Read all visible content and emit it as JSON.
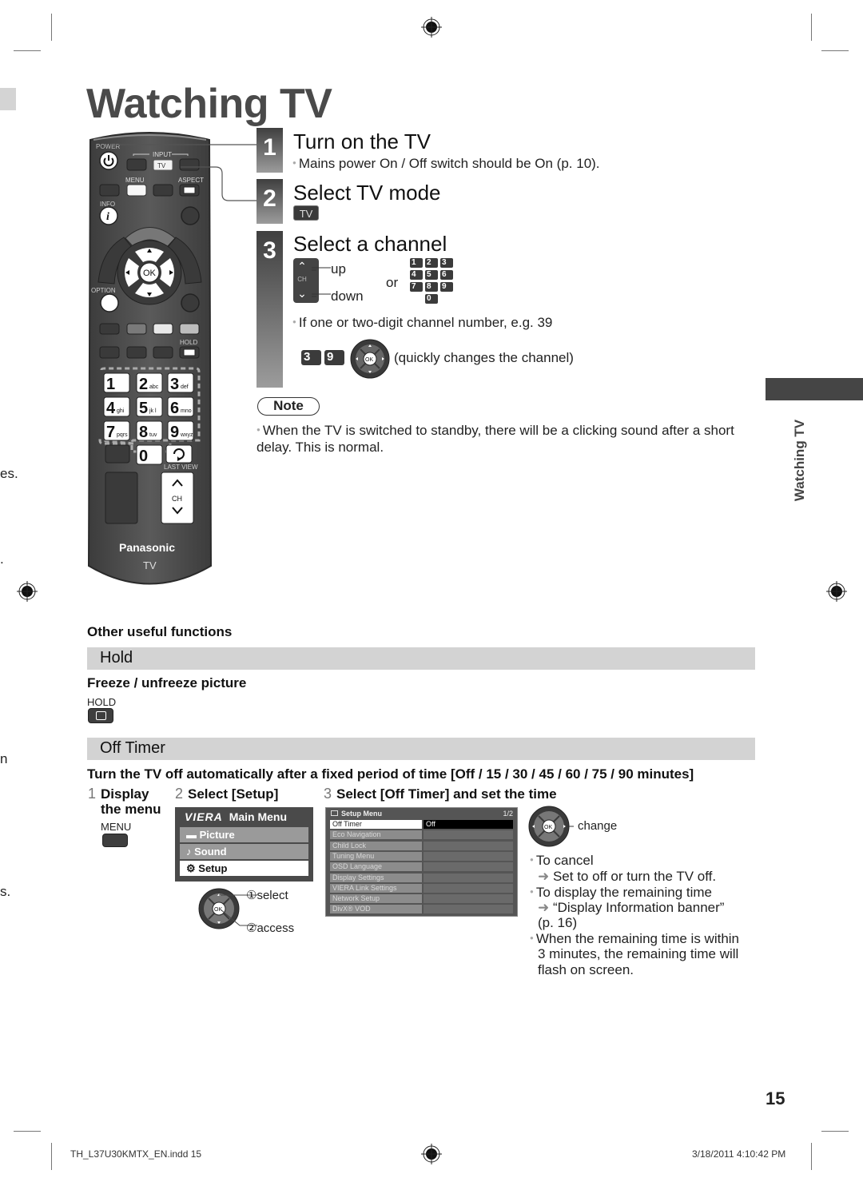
{
  "page": {
    "title": "Watching TV",
    "side_tab_label": "Watching TV",
    "page_number": "15",
    "footer_left": "TH_L37U30KMTX_EN.indd   15",
    "footer_right": "3/18/2011   4:10:42 PM",
    "left_margin_fragments": [
      "es.",
      ".",
      "n",
      "s."
    ]
  },
  "remote": {
    "labels": {
      "power": "POWER",
      "input": "INPUT",
      "tv": "TV",
      "menu": "MENU",
      "aspect": "ASPECT",
      "info": "INFO",
      "ok": "OK",
      "option": "OPTION",
      "hold": "HOLD",
      "last_view": "LAST VIEW",
      "ch": "CH",
      "brand": "Panasonic",
      "model": "TV"
    },
    "number_keys": [
      {
        "digit": "1",
        "letters": ""
      },
      {
        "digit": "2",
        "letters": "abc"
      },
      {
        "digit": "3",
        "letters": "def"
      },
      {
        "digit": "4",
        "letters": "ghi"
      },
      {
        "digit": "5",
        "letters": "jk l"
      },
      {
        "digit": "6",
        "letters": "mno"
      },
      {
        "digit": "7",
        "letters": "pqrs"
      },
      {
        "digit": "8",
        "letters": "tuv"
      },
      {
        "digit": "9",
        "letters": "wxyz"
      },
      {
        "digit": "0",
        "letters": ""
      }
    ]
  },
  "steps": [
    {
      "number": "1",
      "title": "Turn on the TV",
      "body": "Mains power On / Off switch should be On (p. 10)."
    },
    {
      "number": "2",
      "title": "Select TV mode",
      "chip": "TV"
    },
    {
      "number": "3",
      "title": "Select a channel",
      "up_label": "up",
      "down_label": "down",
      "or_label": "or",
      "ch_label": "CH",
      "tip": "If one or two-digit channel number, e.g. 39",
      "example_keys": [
        "3",
        "9"
      ],
      "example_note": "(quickly changes the channel)"
    }
  ],
  "note": {
    "label": "Note",
    "text": "When the TV is switched to standby, there will be a clicking sound after a short delay. This is normal."
  },
  "other": {
    "heading": "Other useful functions",
    "hold": {
      "title": "Hold",
      "subtitle": "Freeze / unfreeze picture",
      "key_label": "HOLD"
    },
    "off_timer": {
      "title": "Off Timer",
      "description": "Turn the TV off automatically after a fixed period of time [Off / 15 / 30 / 45 / 60 / 75 / 90 minutes]",
      "step1": {
        "num": "1",
        "text_line1": "Display",
        "text_line2": "the menu",
        "key_label": "MENU"
      },
      "step2": {
        "num": "2",
        "text": "Select [Setup]",
        "select_label": "①select",
        "access_label": "②access"
      },
      "step3": {
        "num": "3",
        "text": "Select [Off Timer] and set the time",
        "change_label": "change"
      },
      "main_menu": {
        "title": "Main Menu",
        "brand": "VIERA",
        "items": [
          {
            "label": "Picture",
            "state": "normal"
          },
          {
            "label": "Sound",
            "state": "normal"
          },
          {
            "label": "Setup",
            "state": "selected"
          }
        ]
      },
      "setup_menu": {
        "title": "Setup Menu",
        "page": "1/2",
        "rows": [
          {
            "label": "Off Timer",
            "value": "Off",
            "selected": true
          },
          {
            "label": "Eco Navigation",
            "value": ""
          },
          {
            "label": "Child Lock",
            "value": ""
          },
          {
            "label": "Tuning Menu",
            "value": ""
          },
          {
            "label": "OSD Language",
            "value": ""
          },
          {
            "label": "Display Settings",
            "value": ""
          },
          {
            "label": "VIERA Link Settings",
            "value": ""
          },
          {
            "label": "Network Setup",
            "value": ""
          },
          {
            "label": "DivX® VOD",
            "value": ""
          }
        ]
      },
      "tips": [
        {
          "text": "To cancel",
          "sub": "Set to off or turn the TV off."
        },
        {
          "text": "To display the remaining time",
          "sub": "“Display Information banner”",
          "sub2": "(p. 16)"
        },
        {
          "text": "When the remaining time is within",
          "line2": "3 minutes, the remaining time will",
          "line3": "flash on screen."
        }
      ]
    }
  },
  "colors": {
    "title": "#4a4a4a",
    "remote_body": "#4b4b4b",
    "section_bar": "#d3d3d3",
    "side_tab": "#454545"
  }
}
